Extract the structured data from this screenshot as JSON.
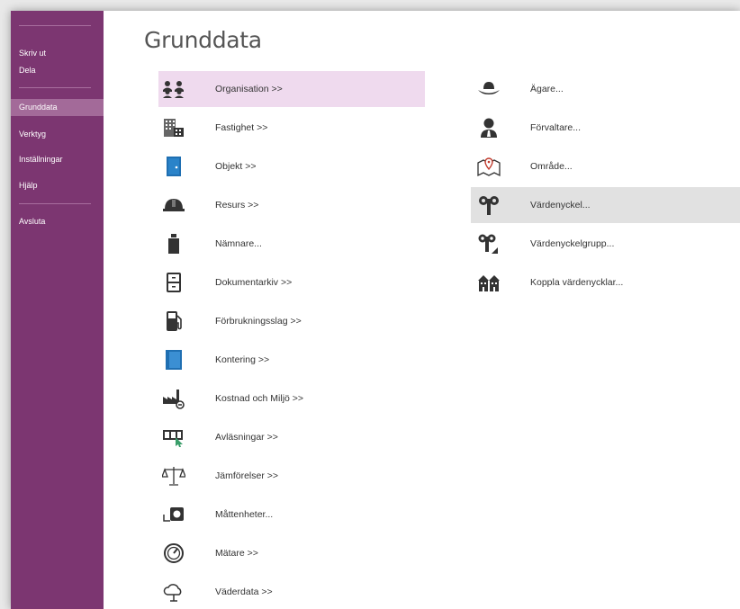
{
  "sidebar": {
    "items": [
      {
        "label": "Skriv ut",
        "icon": "print"
      },
      {
        "label": "Dela",
        "icon": "share"
      },
      {
        "label": "Grunddata",
        "icon": "data",
        "active": true
      },
      {
        "label": "Verktyg",
        "icon": "tools"
      },
      {
        "label": "Inställningar",
        "icon": "settings"
      },
      {
        "label": "Hjälp",
        "icon": "help"
      },
      {
        "label": "Avsluta",
        "icon": "exit"
      }
    ]
  },
  "main": {
    "title": "Grunddata",
    "left_items": [
      {
        "label": "Organisation >>",
        "icon": "people-icon"
      },
      {
        "label": "Fastighet >>",
        "icon": "building-icon"
      },
      {
        "label": "Objekt >>",
        "icon": "door-icon"
      },
      {
        "label": "Resurs >>",
        "icon": "hardhat-icon"
      },
      {
        "label": "Nämnare...",
        "icon": "weight-icon"
      },
      {
        "label": "Dokumentarkiv >>",
        "icon": "cabinet-icon"
      },
      {
        "label": "Förbrukningsslag >>",
        "icon": "fuel-pump-icon"
      },
      {
        "label": "Kontering >>",
        "icon": "ledger-icon"
      },
      {
        "label": "Kostnad och Miljö >>",
        "icon": "factory-icon"
      },
      {
        "label": "Avläsningar >>",
        "icon": "meter-reading-icon"
      },
      {
        "label": "Jämförelser >>",
        "icon": "scales-icon"
      },
      {
        "label": "Måttenheter...",
        "icon": "units-icon"
      },
      {
        "label": "Mätare >>",
        "icon": "gauge-icon"
      },
      {
        "label": "Väderdata >>",
        "icon": "cloud-icon"
      }
    ],
    "right_items": [
      {
        "label": "Ägare...",
        "icon": "hat-icon"
      },
      {
        "label": "Förvaltare...",
        "icon": "manager-icon"
      },
      {
        "label": "Område...",
        "icon": "map-pin-icon"
      },
      {
        "label": "Värdenyckel...",
        "icon": "key-icon"
      },
      {
        "label": "Värdenyckelgrupp...",
        "icon": "key-group-icon"
      },
      {
        "label": "Koppla värdenycklar...",
        "icon": "link-buildings-icon"
      }
    ]
  },
  "colors": {
    "sidebar_bg": "#7c3671",
    "sidebar_active": "#a36a99",
    "hover_left": "#efdaee",
    "hover_right": "#e1e1e1",
    "icon_dark": "#333333",
    "icon_blue": "#1f6fb2"
  }
}
